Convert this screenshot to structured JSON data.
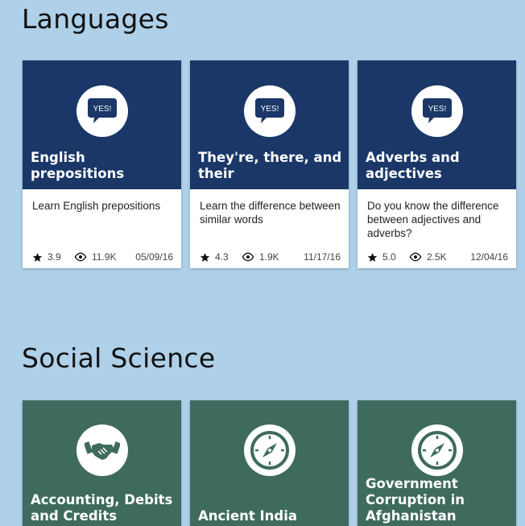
{
  "sections": [
    {
      "title": "Languages",
      "cards": [
        {
          "title": "English prepositions",
          "description": "Learn English prepositions",
          "rating": "3.9",
          "views": "11.9K",
          "date": "05/09/16",
          "icon": "yes-speech-bubble-icon",
          "icon_text": "YES!"
        },
        {
          "title": "They're, there, and their",
          "description": "Learn the difference between similar words",
          "rating": "4.3",
          "views": "1.9K",
          "date": "11/17/16",
          "icon": "yes-speech-bubble-icon",
          "icon_text": "YES!"
        },
        {
          "title": "Adverbs and adjectives",
          "description": "Do you know the difference between adjectives and adverbs?",
          "rating": "5.0",
          "views": "2.5K",
          "date": "12/04/16",
          "icon": "yes-speech-bubble-icon",
          "icon_text": "YES!"
        }
      ]
    },
    {
      "title": "Social Science",
      "cards": [
        {
          "title": "Accounting, Debits and Credits",
          "icon": "handshake-icon"
        },
        {
          "title": "Ancient India",
          "icon": "compass-icon"
        },
        {
          "title": "Government Corruption in Afghanistan",
          "icon": "compass-icon"
        }
      ]
    }
  ],
  "colors": {
    "background": "#aed0e8",
    "languages_card_header": "#1a3768",
    "social_science_card_header": "#3e6b5e"
  }
}
